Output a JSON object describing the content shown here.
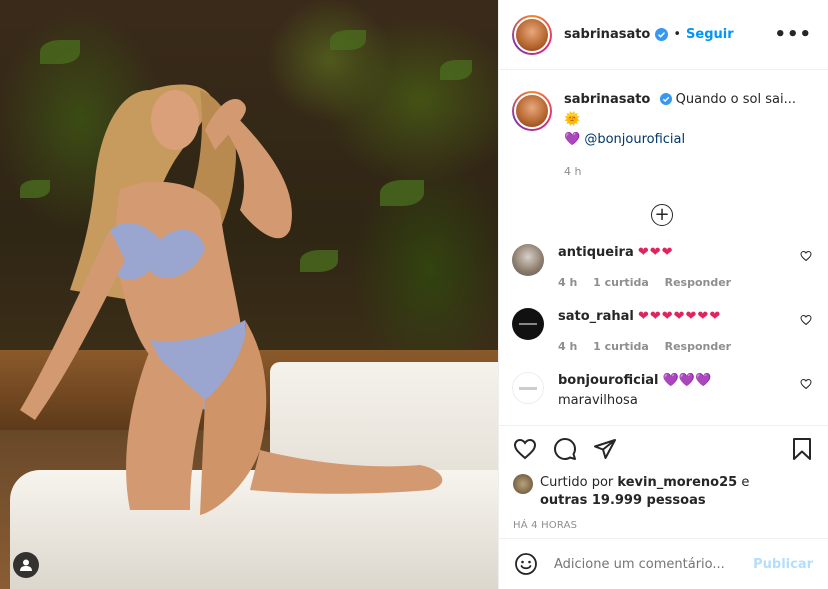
{
  "post": {
    "username": "sabrinasato",
    "separator": "•",
    "follow_label": "Seguir",
    "more_label": "•••",
    "caption": "Quando o sol sai...",
    "caption_emoji": "🌞",
    "caption_heart": "💜",
    "caption_mention": "@bonjouroficial",
    "caption_time": "4 h",
    "load_more": "+"
  },
  "comments": [
    {
      "username": "antiqueira",
      "text": "❤❤❤",
      "time": "4 h",
      "likes": "1 curtida",
      "reply": "Responder"
    },
    {
      "username": "sato_rahal",
      "text": "❤❤❤❤❤❤❤",
      "time": "4 h",
      "likes": "1 curtida",
      "reply": "Responder"
    },
    {
      "username": "bonjouroficial",
      "text": "💜💜💜",
      "text2": "maravilhosa"
    }
  ],
  "likes": {
    "prefix": "Curtido por",
    "user": "kevin_moreno25",
    "conj": "e",
    "others": "outras 19.999 pessoas"
  },
  "time_ago": "HÁ 4 HORAS",
  "add_comment": {
    "placeholder": "Adicione um comentário...",
    "publish_label": "Publicar"
  },
  "colors": {
    "accent": "#0095f6",
    "verified": "#3897f0",
    "heart": "#e0245e",
    "publish_disabled": "#b2dffc"
  }
}
